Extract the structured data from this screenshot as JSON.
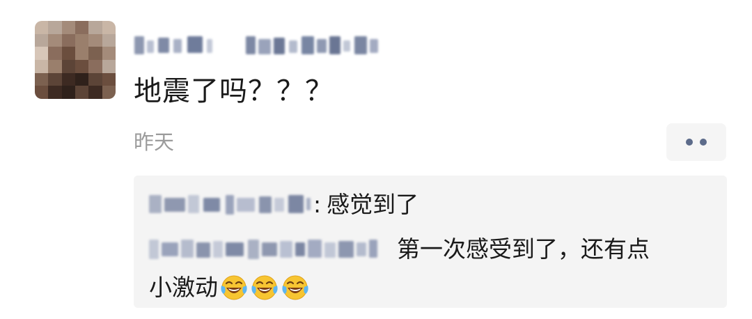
{
  "post": {
    "text": "地震了吗？？？",
    "timestamp": "昨天"
  },
  "more_button": {
    "icon": "more-dots-icon"
  },
  "comments": [
    {
      "separator": ":",
      "text": "感觉到了"
    },
    {
      "line1": "第一次感受到了，还有点",
      "line2": "小激动",
      "emojis": [
        "tears-of-joy-emoji",
        "tears-of-joy-emoji",
        "tears-of-joy-emoji"
      ]
    }
  ],
  "colors": {
    "timestamp": "#9b9b9b",
    "text": "#1a1a1a",
    "comment_background": "#f4f4f4",
    "more_dots": "#5c6b8a"
  }
}
